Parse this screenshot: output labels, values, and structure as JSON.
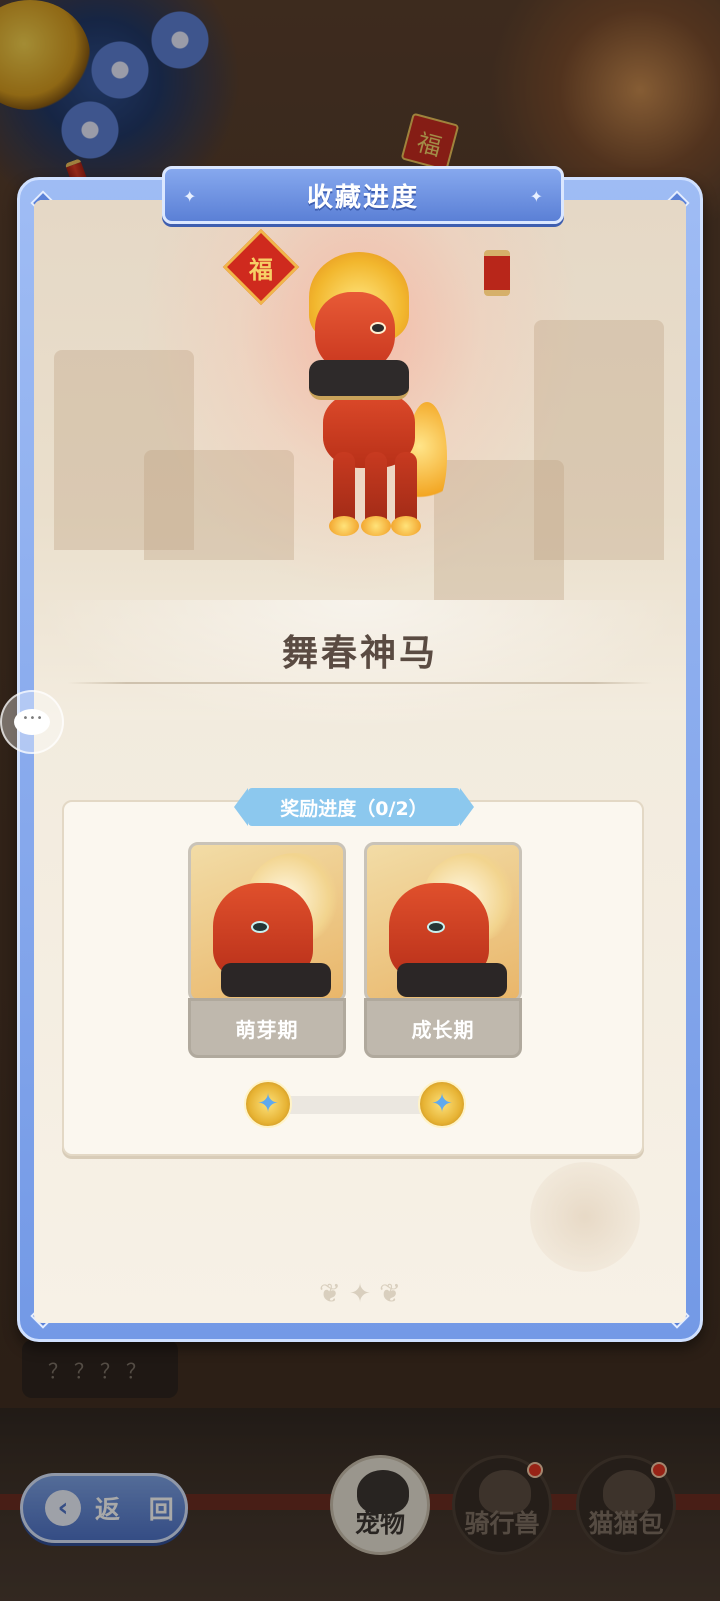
{
  "background": {
    "side_list": [
      "？？？？"
    ],
    "lantern_glyph": "福"
  },
  "modal": {
    "title": "收藏进度",
    "pet_name": "舞春神马",
    "fu_glyph": "福",
    "reward": {
      "banner": "奖励进度（0/2）",
      "progress_fraction": 0.0,
      "stages": [
        {
          "label": "萌芽期"
        },
        {
          "label": "成长期"
        }
      ]
    }
  },
  "bottom_nav": {
    "back_label": "返 回",
    "tabs": [
      {
        "label": "宠物",
        "active": true
      },
      {
        "label": "骑行兽",
        "active": false
      },
      {
        "label": "猫猫包",
        "active": false
      }
    ]
  },
  "colors": {
    "frame_blue": "#7399e6",
    "banner_blue": "#8cc8ee",
    "stage_gray": "#bfb8ad",
    "red_dot": "#e3321f"
  }
}
